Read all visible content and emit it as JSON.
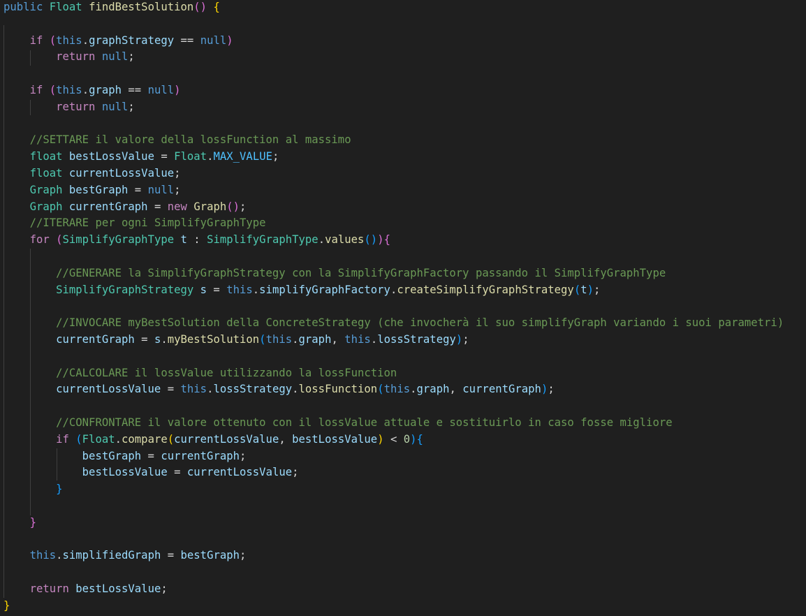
{
  "colors": {
    "background": "#1f1f1f",
    "indent_guide": "#404040",
    "keyword": "#569cd6",
    "control": "#c586c0",
    "type": "#4ec9b0",
    "function": "#dcdcaa",
    "variable": "#9cdcfe",
    "constant": "#4fc1ff",
    "comment": "#6a9955",
    "number": "#b5cea8",
    "plain": "#d4d4d4",
    "bracket_gold": "#ffd700",
    "bracket_purple": "#da70d6",
    "bracket_blue": "#179fff"
  },
  "code": {
    "lines": [
      [
        [
          "keyword",
          "public"
        ],
        [
          "plain",
          " "
        ],
        [
          "type",
          "Float"
        ],
        [
          "plain",
          " "
        ],
        [
          "function",
          "findBestSolution"
        ],
        [
          "bracket_purple",
          "()"
        ],
        [
          "plain",
          " "
        ],
        [
          "bracket_gold",
          "{"
        ]
      ],
      [],
      [
        [
          "plain",
          "    "
        ],
        [
          "control",
          "if"
        ],
        [
          "plain",
          " "
        ],
        [
          "bracket_purple",
          "("
        ],
        [
          "keyword",
          "this"
        ],
        [
          "plain",
          "."
        ],
        [
          "variable",
          "graphStrategy"
        ],
        [
          "plain",
          " == "
        ],
        [
          "keyword",
          "null"
        ],
        [
          "bracket_purple",
          ")"
        ]
      ],
      [
        [
          "plain",
          "        "
        ],
        [
          "control",
          "return"
        ],
        [
          "plain",
          " "
        ],
        [
          "keyword",
          "null"
        ],
        [
          "plain",
          ";"
        ]
      ],
      [],
      [
        [
          "plain",
          "    "
        ],
        [
          "control",
          "if"
        ],
        [
          "plain",
          " "
        ],
        [
          "bracket_purple",
          "("
        ],
        [
          "keyword",
          "this"
        ],
        [
          "plain",
          "."
        ],
        [
          "variable",
          "graph"
        ],
        [
          "plain",
          " == "
        ],
        [
          "keyword",
          "null"
        ],
        [
          "bracket_purple",
          ")"
        ]
      ],
      [
        [
          "plain",
          "        "
        ],
        [
          "control",
          "return"
        ],
        [
          "plain",
          " "
        ],
        [
          "keyword",
          "null"
        ],
        [
          "plain",
          ";"
        ]
      ],
      [],
      [
        [
          "plain",
          "    "
        ],
        [
          "comment",
          "//SETTARE il valore della lossFunction al massimo"
        ]
      ],
      [
        [
          "plain",
          "    "
        ],
        [
          "type",
          "float"
        ],
        [
          "plain",
          " "
        ],
        [
          "variable",
          "bestLossValue"
        ],
        [
          "plain",
          " = "
        ],
        [
          "type",
          "Float"
        ],
        [
          "plain",
          "."
        ],
        [
          "constant",
          "MAX_VALUE"
        ],
        [
          "plain",
          ";"
        ]
      ],
      [
        [
          "plain",
          "    "
        ],
        [
          "type",
          "float"
        ],
        [
          "plain",
          " "
        ],
        [
          "variable",
          "currentLossValue"
        ],
        [
          "plain",
          ";"
        ]
      ],
      [
        [
          "plain",
          "    "
        ],
        [
          "type",
          "Graph"
        ],
        [
          "plain",
          " "
        ],
        [
          "variable",
          "bestGraph"
        ],
        [
          "plain",
          " = "
        ],
        [
          "keyword",
          "null"
        ],
        [
          "plain",
          ";"
        ]
      ],
      [
        [
          "plain",
          "    "
        ],
        [
          "type",
          "Graph"
        ],
        [
          "plain",
          " "
        ],
        [
          "variable",
          "currentGraph"
        ],
        [
          "plain",
          " = "
        ],
        [
          "control",
          "new"
        ],
        [
          "plain",
          " "
        ],
        [
          "function",
          "Graph"
        ],
        [
          "bracket_purple",
          "()"
        ],
        [
          "plain",
          ";"
        ]
      ],
      [
        [
          "plain",
          "    "
        ],
        [
          "comment",
          "//ITERARE per ogni SimplifyGraphType"
        ]
      ],
      [
        [
          "plain",
          "    "
        ],
        [
          "control",
          "for"
        ],
        [
          "plain",
          " "
        ],
        [
          "bracket_purple",
          "("
        ],
        [
          "type",
          "SimplifyGraphType"
        ],
        [
          "plain",
          " "
        ],
        [
          "variable",
          "t"
        ],
        [
          "plain",
          " : "
        ],
        [
          "type",
          "SimplifyGraphType"
        ],
        [
          "plain",
          "."
        ],
        [
          "function",
          "values"
        ],
        [
          "bracket_blue",
          "()"
        ],
        [
          "bracket_purple",
          ")"
        ],
        [
          "bracket_purple",
          "{"
        ]
      ],
      [],
      [
        [
          "plain",
          "        "
        ],
        [
          "comment",
          "//GENERARE la SimplifyGraphStrategy con la SimplifyGraphFactory passando il SimplifyGraphType"
        ]
      ],
      [
        [
          "plain",
          "        "
        ],
        [
          "type",
          "SimplifyGraphStrategy"
        ],
        [
          "plain",
          " "
        ],
        [
          "variable",
          "s"
        ],
        [
          "plain",
          " = "
        ],
        [
          "keyword",
          "this"
        ],
        [
          "plain",
          "."
        ],
        [
          "variable",
          "simplifyGraphFactory"
        ],
        [
          "plain",
          "."
        ],
        [
          "function",
          "createSimplifyGraphStrategy"
        ],
        [
          "bracket_blue",
          "("
        ],
        [
          "variable",
          "t"
        ],
        [
          "bracket_blue",
          ")"
        ],
        [
          "plain",
          ";"
        ]
      ],
      [],
      [
        [
          "plain",
          "        "
        ],
        [
          "comment",
          "//INVOCARE myBestSolution della ConcreteStrategy (che invocherà il suo simplifyGraph variando i suoi parametri)"
        ]
      ],
      [
        [
          "plain",
          "        "
        ],
        [
          "variable",
          "currentGraph"
        ],
        [
          "plain",
          " = "
        ],
        [
          "variable",
          "s"
        ],
        [
          "plain",
          "."
        ],
        [
          "function",
          "myBestSolution"
        ],
        [
          "bracket_blue",
          "("
        ],
        [
          "keyword",
          "this"
        ],
        [
          "plain",
          "."
        ],
        [
          "variable",
          "graph"
        ],
        [
          "plain",
          ", "
        ],
        [
          "keyword",
          "this"
        ],
        [
          "plain",
          "."
        ],
        [
          "variable",
          "lossStrategy"
        ],
        [
          "bracket_blue",
          ")"
        ],
        [
          "plain",
          ";"
        ]
      ],
      [],
      [
        [
          "plain",
          "        "
        ],
        [
          "comment",
          "//CALCOLARE il lossValue utilizzando la lossFunction"
        ]
      ],
      [
        [
          "plain",
          "        "
        ],
        [
          "variable",
          "currentLossValue"
        ],
        [
          "plain",
          " = "
        ],
        [
          "keyword",
          "this"
        ],
        [
          "plain",
          "."
        ],
        [
          "variable",
          "lossStrategy"
        ],
        [
          "plain",
          "."
        ],
        [
          "function",
          "lossFunction"
        ],
        [
          "bracket_blue",
          "("
        ],
        [
          "keyword",
          "this"
        ],
        [
          "plain",
          "."
        ],
        [
          "variable",
          "graph"
        ],
        [
          "plain",
          ", "
        ],
        [
          "variable",
          "currentGraph"
        ],
        [
          "bracket_blue",
          ")"
        ],
        [
          "plain",
          ";"
        ]
      ],
      [],
      [
        [
          "plain",
          "        "
        ],
        [
          "comment",
          "//CONFRONTARE il valore ottenuto con il lossValue attuale e sostituirlo in caso fosse migliore"
        ]
      ],
      [
        [
          "plain",
          "        "
        ],
        [
          "control",
          "if"
        ],
        [
          "plain",
          " "
        ],
        [
          "bracket_blue",
          "("
        ],
        [
          "type",
          "Float"
        ],
        [
          "plain",
          "."
        ],
        [
          "function",
          "compare"
        ],
        [
          "bracket_gold",
          "("
        ],
        [
          "variable",
          "currentLossValue"
        ],
        [
          "plain",
          ", "
        ],
        [
          "variable",
          "bestLossValue"
        ],
        [
          "bracket_gold",
          ")"
        ],
        [
          "plain",
          " < "
        ],
        [
          "number",
          "0"
        ],
        [
          "bracket_blue",
          ")"
        ],
        [
          "bracket_blue",
          "{"
        ]
      ],
      [
        [
          "plain",
          "            "
        ],
        [
          "variable",
          "bestGraph"
        ],
        [
          "plain",
          " = "
        ],
        [
          "variable",
          "currentGraph"
        ],
        [
          "plain",
          ";"
        ]
      ],
      [
        [
          "plain",
          "            "
        ],
        [
          "variable",
          "bestLossValue"
        ],
        [
          "plain",
          " = "
        ],
        [
          "variable",
          "currentLossValue"
        ],
        [
          "plain",
          ";"
        ]
      ],
      [
        [
          "plain",
          "        "
        ],
        [
          "bracket_blue",
          "}"
        ]
      ],
      [],
      [
        [
          "plain",
          "    "
        ],
        [
          "bracket_purple",
          "}"
        ]
      ],
      [],
      [
        [
          "plain",
          "    "
        ],
        [
          "keyword",
          "this"
        ],
        [
          "plain",
          "."
        ],
        [
          "variable",
          "simplifiedGraph"
        ],
        [
          "plain",
          " = "
        ],
        [
          "variable",
          "bestGraph"
        ],
        [
          "plain",
          ";"
        ]
      ],
      [],
      [
        [
          "plain",
          "    "
        ],
        [
          "control",
          "return"
        ],
        [
          "plain",
          " "
        ],
        [
          "variable",
          "bestLossValue"
        ],
        [
          "plain",
          ";"
        ]
      ],
      [
        [
          "bracket_gold",
          "}"
        ]
      ]
    ]
  }
}
